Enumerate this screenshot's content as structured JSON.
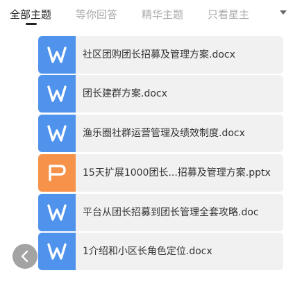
{
  "tabs": [
    {
      "label": "全部主题",
      "active": true
    },
    {
      "label": "等你回答",
      "active": false
    },
    {
      "label": "精华主题",
      "active": false
    },
    {
      "label": "只看星主",
      "active": false
    }
  ],
  "files": [
    {
      "type": "doc",
      "icon": "word-doc-icon",
      "name": "社区团购团长招募及管理方案.docx"
    },
    {
      "type": "doc",
      "icon": "word-doc-icon",
      "name": "团长建群方案.docx"
    },
    {
      "type": "doc",
      "icon": "word-doc-icon",
      "name": "渔乐圈社群运营管理及绩效制度.docx"
    },
    {
      "type": "ppt",
      "icon": "powerpoint-ppt-icon",
      "name": "15天扩展1000团长...招募及管理方案.pptx"
    },
    {
      "type": "doc",
      "icon": "word-doc-icon",
      "name": "平台从团长招募到团长管理全套攻略.doc"
    },
    {
      "type": "doc",
      "icon": "word-doc-icon",
      "name": "1介绍和小区长角色定位.docx"
    }
  ],
  "colors": {
    "doc_icon": "#4f93ec",
    "ppt_icon": "#f6924a",
    "card_bg": "#f1f1f1",
    "tab_active": "#222222",
    "tab_inactive": "#a9a9a9"
  }
}
